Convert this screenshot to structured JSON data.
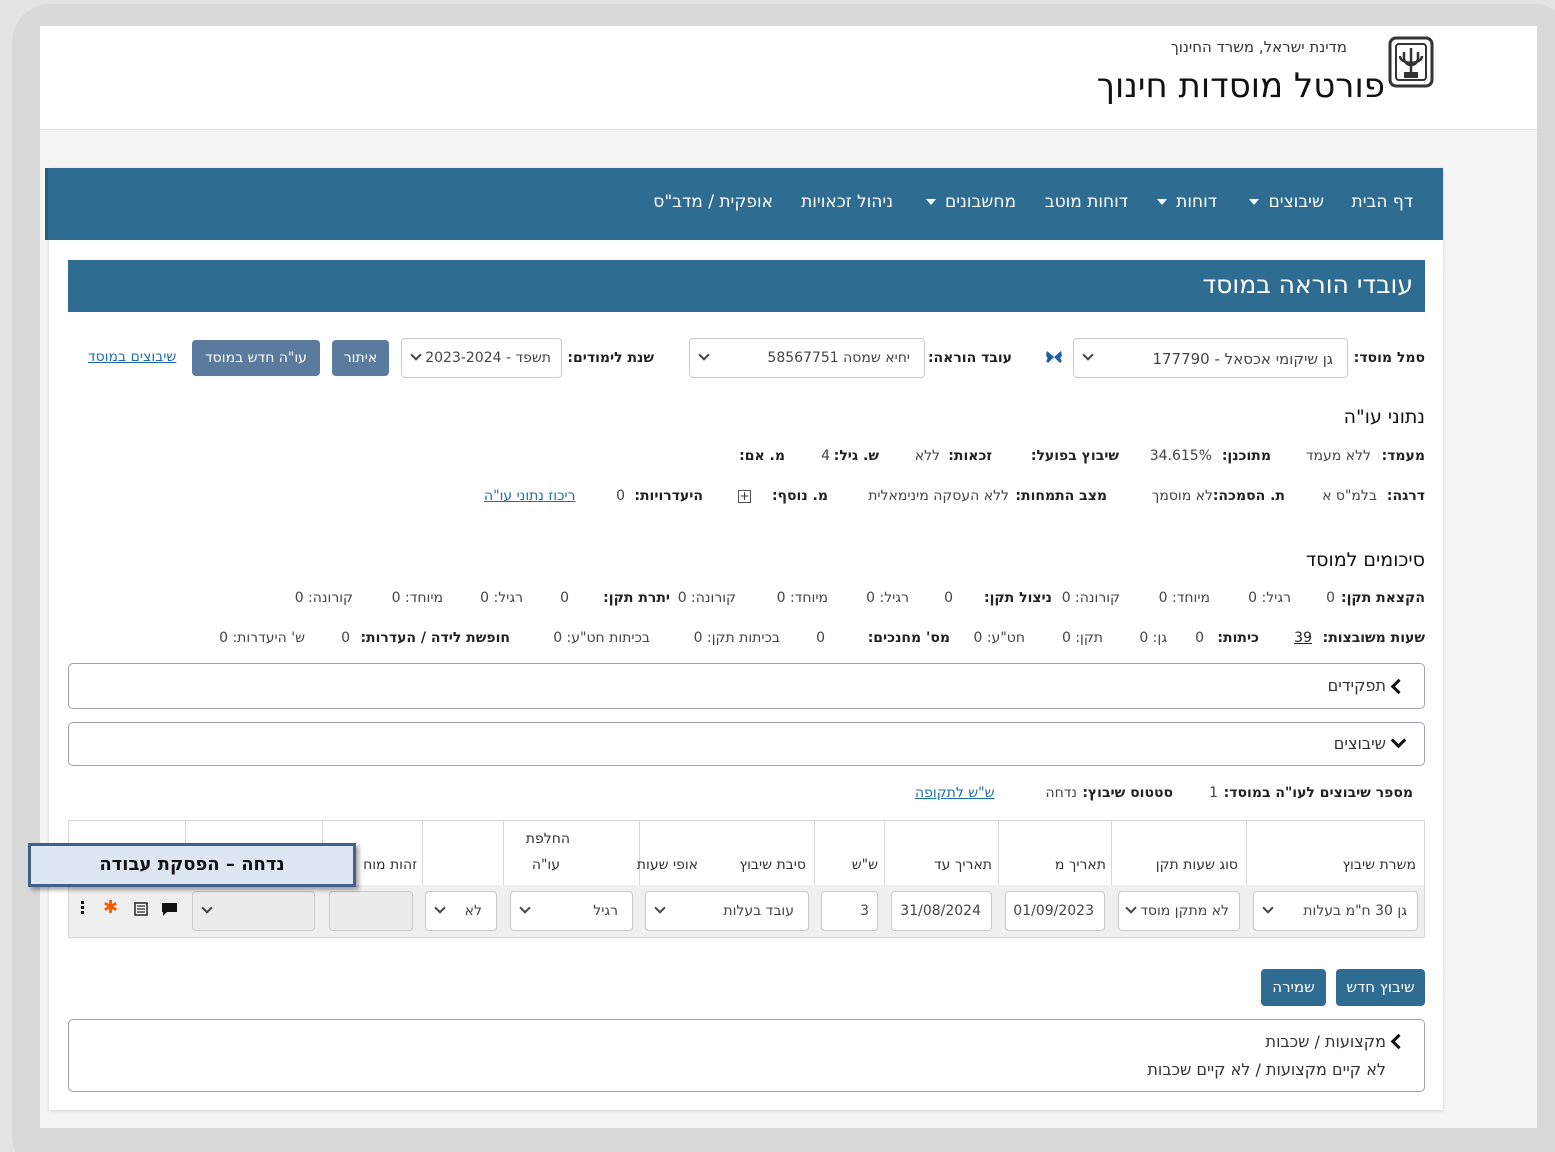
{
  "header": {
    "state_line": "מדינת ישראל, משרד החינוך",
    "portal_title": "פורטל מוסדות חינוך"
  },
  "nav": {
    "home": "דף הבית",
    "assignments": "שיבוצים",
    "reports": "דוחות",
    "mutav_reports": "דוחות מוטב",
    "calculators": "מחשבונים",
    "rights": "ניהול זכאויות",
    "ofek": "אופקית / מדב\"ס"
  },
  "page": {
    "title": "עובדי הוראה במוסד"
  },
  "filters": {
    "institution_label": "סמל מוסד:",
    "institution_value": "גן שיקומי אכסאל - 177790",
    "teacher_label": "עובד הוראה:",
    "teacher_value": "יחיא שמסה 58567751",
    "year_label": "שנת לימודים:",
    "year_value": "תשפד - 2023-2024",
    "search_btn": "איתור",
    "new_teacher_btn": "עו\"ה חדש במוסד",
    "assignments_link": "שיבוצים במוסד"
  },
  "teacher_data": {
    "heading": "נתוני עו\"ה",
    "status_label": "מעמד:",
    "status_value": "ללא מעמד",
    "plan_label": "מתוכנן:",
    "plan_value": "34.615%",
    "actual_label": "שיבוץ בפועל:",
    "rights_label": "זכאות:",
    "rights_value": "ללא",
    "age_label": "ש. גיל:",
    "age_value": "4",
    "mother_label": "מ. אם:",
    "grade_label": "דרגה:",
    "grade_value": "בלמ\"ס א",
    "cert_label": "ת. הסמכה:",
    "cert_value": "לא מוסמך",
    "spec_label": "מצב התמחות:",
    "spec_value": "ללא העסקה מינימאלית",
    "extra_label": "מ. נוסף:",
    "absence_label": "היעדרויות:",
    "absence_value": "0",
    "summary_link": "ריכוז נתוני עו\"ה"
  },
  "summaries": {
    "heading": "סיכומים למוסד",
    "row1": {
      "alloc_label": "הקצאת תקן:",
      "alloc_value": "0",
      "regular1": "רגיל: 0",
      "special1": "מיוחד: 0",
      "corona1": "קורונה: 0",
      "usage_label": "ניצול תקן:",
      "usage_value": "0",
      "regular2": "רגיל: 0",
      "special2": "מיוחד: 0",
      "corona2": "קורונה: 0",
      "balance_label": "יתרת תקן:",
      "balance_value": "0",
      "regular3": "רגיל: 0",
      "special3": "מיוחד: 0",
      "corona3": "קורונה: 0"
    },
    "row2": {
      "hours_label": "שעות משובצות:",
      "hours_value": "39",
      "classes_label": "כיתות:",
      "classes_value": "0",
      "kinder": "גן: 0",
      "standard": "תקן: 0",
      "hatea": "חט\"ע: 0",
      "teachers_label": "מס' מחנכים:",
      "teachers_value": "0",
      "class_std": "בכיתות תקן: 0",
      "class_hatea": "בכיתות חט\"ע: 0",
      "leave_label": "חופשת לידה / העדרות:",
      "leave_value": "0",
      "absence_hours": "ש' היעדרות: 0"
    }
  },
  "panels": {
    "roles": "תפקידים",
    "assignments": "שיבוצים",
    "clusters": "מקצועות / שכבות",
    "clusters_body": "לא קיים מקצועות / לא קיים שכבות"
  },
  "assign_info": {
    "count_label": "מספר שיבוצים לעו\"ה במוסד:",
    "count_value": "1",
    "status_label": "סטטוס שיבוץ:",
    "status_value": "נדחה",
    "period_link": "ש\"ש לתקופה"
  },
  "table": {
    "headers": {
      "position": "משרת שיבוץ",
      "hours_type": "סוג שעות תקן",
      "from": "תאריך מ",
      "to": "תאריך עד",
      "ss": "ש\"ש",
      "reason": "סיבת שיבוץ",
      "hours_mode": "אופי שעות",
      "replace_l1": "החלפת",
      "replace_l2": "עו\"ה",
      "id_cut": "זהות מוח"
    },
    "row": {
      "position": "גן 30 ח\"מ בעלות",
      "hours_type": "לא מתקן מוסד",
      "from": "01/09/2023",
      "to": "31/08/2024",
      "ss": "3",
      "reason": "עובד בעלות",
      "hours_mode": "רגיל",
      "replace": "לא"
    }
  },
  "buttons": {
    "new_assignment": "שיבוץ חדש",
    "save": "שמירה"
  },
  "tooltip": "נדחה – הפסקת עבודה",
  "colors": {
    "brand": "#2e6d91",
    "button": "#5a7a9e",
    "asterisk": "#ff5a00"
  }
}
